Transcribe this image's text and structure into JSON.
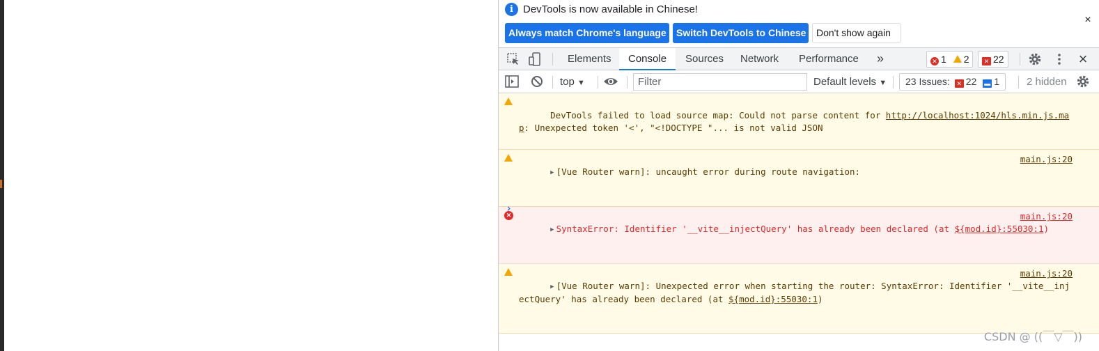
{
  "infobar": {
    "message": "DevTools is now available in Chinese!",
    "btn_match": "Always match Chrome's language",
    "btn_switch": "Switch DevTools to Chinese",
    "btn_dont_show": "Don't show again",
    "close": "×"
  },
  "tabs": [
    {
      "label": "Elements"
    },
    {
      "label": "Console"
    },
    {
      "label": "Sources"
    },
    {
      "label": "Network"
    },
    {
      "label": "Performance"
    }
  ],
  "toolbar": {
    "more_tabs": "»",
    "counts": {
      "errors": "1",
      "warnings": "2",
      "issues": "22"
    },
    "close": "×"
  },
  "console_toolbar": {
    "context": "top",
    "filter_placeholder": "Filter",
    "levels": "Default levels",
    "issues_label": "23 Issues:",
    "issues_errors": "22",
    "issues_info": "1",
    "hidden": "2 hidden"
  },
  "messages": [
    {
      "level": "warning",
      "text_a": "DevTools failed to load source map: Could not parse content for ",
      "link": "http://localhost:1024/hls.min.js.map",
      "text_b": ": Unexpected token '<', \"<!DOCTYPE \"... is not valid JSON"
    },
    {
      "level": "warning",
      "text": "[Vue Router warn]: uncaught error during route navigation:",
      "source": "main.js:20"
    },
    {
      "level": "error",
      "text_a": "SyntaxError: Identifier '__vite__injectQuery' has already been declared (at ",
      "link": "${mod.id}:55030:1",
      "text_b": ")",
      "source": "main.js:20"
    },
    {
      "level": "warning",
      "text_a": "[Vue Router warn]: Unexpected error when starting the router: SyntaxError: Identifier '__vite__injectQuery' has already been declared (at ",
      "link": "${mod.id}:55030:1",
      "text_b": ")",
      "source": "main.js:20"
    }
  ],
  "prompt": "›",
  "watermark": "CSDN @ ((￣▽￣))",
  "colors": {
    "accent": "#1a73e8",
    "error": "#d93025",
    "warning": "#f2a600"
  }
}
